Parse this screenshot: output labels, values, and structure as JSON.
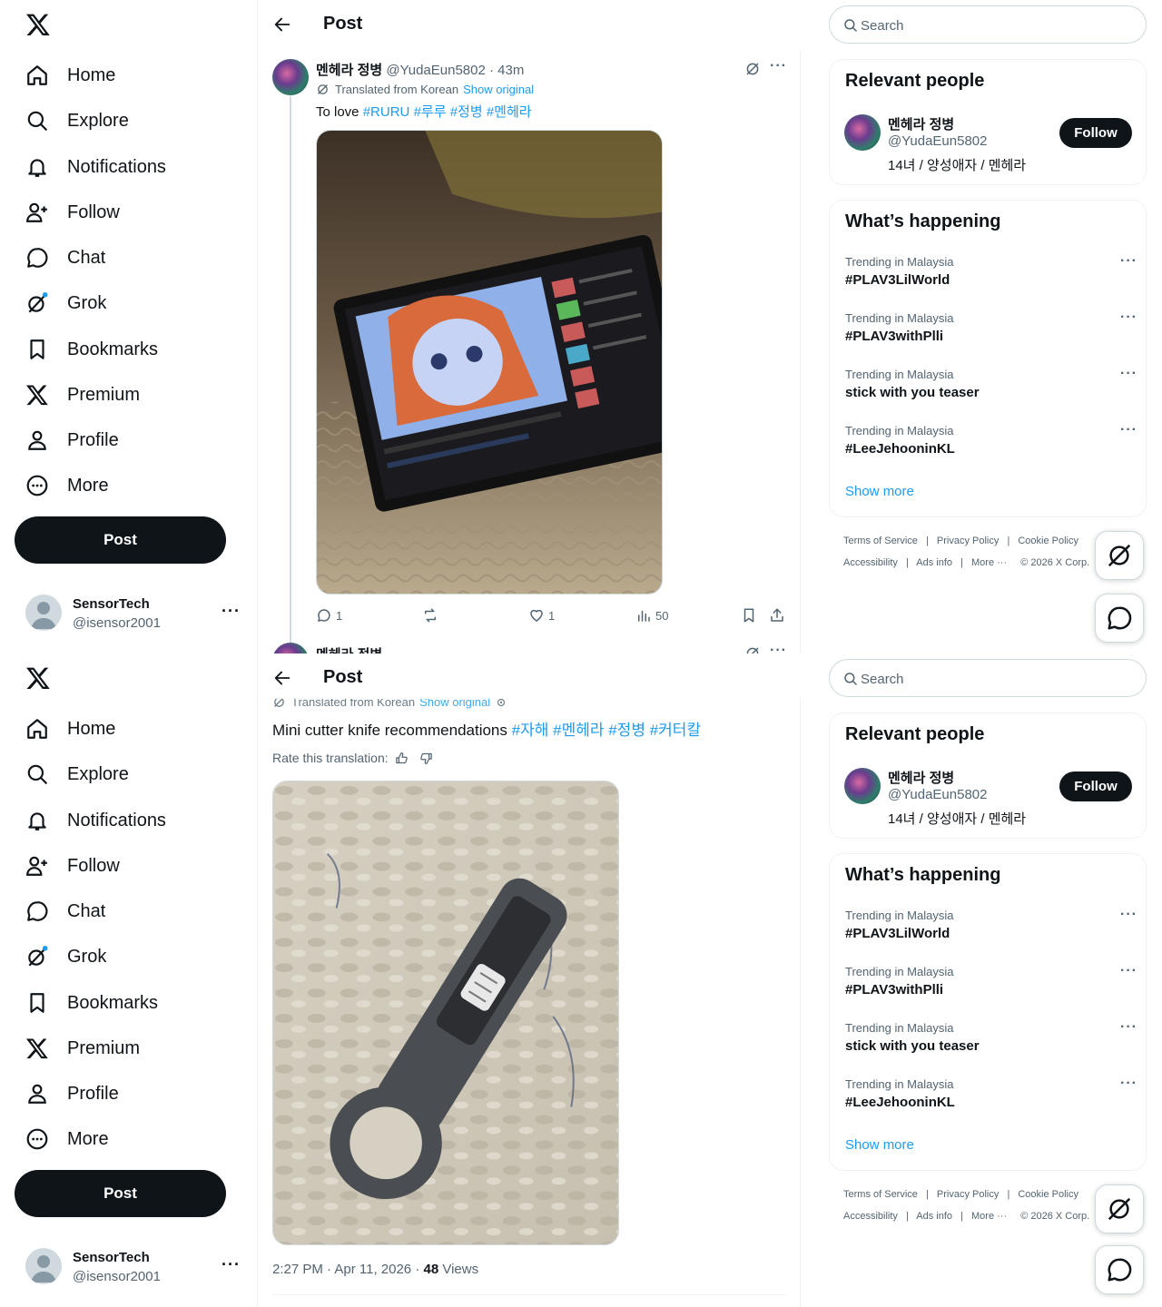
{
  "nav": {
    "items": [
      {
        "label": "Home",
        "icon": "home-icon"
      },
      {
        "label": "Explore",
        "icon": "search-icon"
      },
      {
        "label": "Notifications",
        "icon": "bell-icon"
      },
      {
        "label": "Follow",
        "icon": "add-person-icon"
      },
      {
        "label": "Chat",
        "icon": "chat-icon"
      },
      {
        "label": "Grok",
        "icon": "grok-icon"
      },
      {
        "label": "Bookmarks",
        "icon": "bookmark-icon"
      },
      {
        "label": "Premium",
        "icon": "x-logo-icon"
      },
      {
        "label": "Profile",
        "icon": "person-icon"
      },
      {
        "label": "More",
        "icon": "more-circle-icon"
      }
    ],
    "post_label": "Post"
  },
  "account": {
    "name": "SensorTech",
    "handle": "@isensor2001",
    "more": "···"
  },
  "header": {
    "title": "Post"
  },
  "tweet1": {
    "author": "멘헤라 정병",
    "handle": "@YudaEun5802",
    "time": "· 43m",
    "translated_label": "Translated from Korean",
    "show_original": "Show original",
    "text": "To love",
    "hashtags": [
      "#RURU",
      "#루루",
      "#정병",
      "#멘헤라"
    ],
    "replies": "1",
    "likes": "1",
    "views": "50"
  },
  "tweet2": {
    "author": "멘헤라 정병",
    "translated_label": "Translated from Korean",
    "show_original": "Show original",
    "text": "Mini cutter knife recommendations",
    "hashtags": [
      "#자해",
      "#멘헤라",
      "#정병",
      "#커터칼"
    ],
    "rate_label": "Rate this translation:",
    "timestamp": "2:27 PM · Apr 11, 2026 · ",
    "views_count": "48",
    "views_label": " Views"
  },
  "search": {
    "placeholder": "Search"
  },
  "relevant": {
    "title": "Relevant people",
    "name": "멘헤라 정병",
    "handle": "@YudaEun5802",
    "bio": "14녀 / 양성애자 / 멘헤라",
    "follow_label": "Follow"
  },
  "happening": {
    "title": "What’s happening",
    "trends": [
      {
        "context": "Trending in Malaysia",
        "topic": "#PLAV3LilWorld"
      },
      {
        "context": "Trending in Malaysia",
        "topic": "#PLAV3withPlli"
      },
      {
        "context": "Trending in Malaysia",
        "topic": "stick with you teaser"
      },
      {
        "context": "Trending in Malaysia",
        "topic": "#LeeJehooninKL"
      }
    ],
    "show_more": "Show more"
  },
  "footer": {
    "tos": "Terms of Service",
    "privacy": "Privacy Policy",
    "cookie": "Cookie Policy",
    "accessibility": "Accessibility",
    "ads": "Ads info",
    "more": "More ···",
    "copyright": "© 2026 X Corp."
  },
  "colors": {
    "accent": "#1d9bf0",
    "text": "#0f1419",
    "muted": "#536471",
    "border": "#eff3f4"
  }
}
